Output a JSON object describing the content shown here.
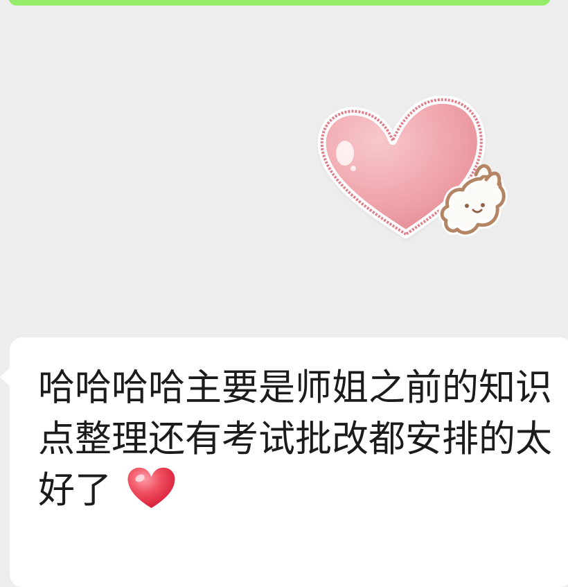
{
  "chat": {
    "message_text": "哈哈哈哈主要是师姐之前的知识点整理还有考试批改都安排的太好了",
    "emoji": "red-heart",
    "sticker": "pink-heart-with-bunny"
  },
  "colors": {
    "background": "#ededed",
    "outgoing_bubble": "#95ec69",
    "incoming_bubble": "#ffffff",
    "text": "#1b1b1b"
  }
}
